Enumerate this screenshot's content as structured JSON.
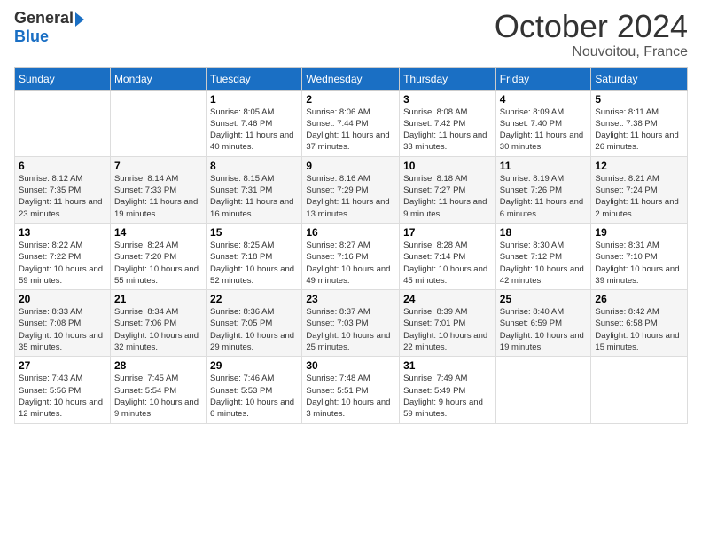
{
  "logo": {
    "general": "General",
    "blue": "Blue"
  },
  "header": {
    "month": "October 2024",
    "location": "Nouvoitou, France"
  },
  "weekdays": [
    "Sunday",
    "Monday",
    "Tuesday",
    "Wednesday",
    "Thursday",
    "Friday",
    "Saturday"
  ],
  "weeks": [
    [
      {
        "day": "",
        "sunrise": "",
        "sunset": "",
        "daylight": ""
      },
      {
        "day": "",
        "sunrise": "",
        "sunset": "",
        "daylight": ""
      },
      {
        "day": "1",
        "sunrise": "Sunrise: 8:05 AM",
        "sunset": "Sunset: 7:46 PM",
        "daylight": "Daylight: 11 hours and 40 minutes."
      },
      {
        "day": "2",
        "sunrise": "Sunrise: 8:06 AM",
        "sunset": "Sunset: 7:44 PM",
        "daylight": "Daylight: 11 hours and 37 minutes."
      },
      {
        "day": "3",
        "sunrise": "Sunrise: 8:08 AM",
        "sunset": "Sunset: 7:42 PM",
        "daylight": "Daylight: 11 hours and 33 minutes."
      },
      {
        "day": "4",
        "sunrise": "Sunrise: 8:09 AM",
        "sunset": "Sunset: 7:40 PM",
        "daylight": "Daylight: 11 hours and 30 minutes."
      },
      {
        "day": "5",
        "sunrise": "Sunrise: 8:11 AM",
        "sunset": "Sunset: 7:38 PM",
        "daylight": "Daylight: 11 hours and 26 minutes."
      }
    ],
    [
      {
        "day": "6",
        "sunrise": "Sunrise: 8:12 AM",
        "sunset": "Sunset: 7:35 PM",
        "daylight": "Daylight: 11 hours and 23 minutes."
      },
      {
        "day": "7",
        "sunrise": "Sunrise: 8:14 AM",
        "sunset": "Sunset: 7:33 PM",
        "daylight": "Daylight: 11 hours and 19 minutes."
      },
      {
        "day": "8",
        "sunrise": "Sunrise: 8:15 AM",
        "sunset": "Sunset: 7:31 PM",
        "daylight": "Daylight: 11 hours and 16 minutes."
      },
      {
        "day": "9",
        "sunrise": "Sunrise: 8:16 AM",
        "sunset": "Sunset: 7:29 PM",
        "daylight": "Daylight: 11 hours and 13 minutes."
      },
      {
        "day": "10",
        "sunrise": "Sunrise: 8:18 AM",
        "sunset": "Sunset: 7:27 PM",
        "daylight": "Daylight: 11 hours and 9 minutes."
      },
      {
        "day": "11",
        "sunrise": "Sunrise: 8:19 AM",
        "sunset": "Sunset: 7:26 PM",
        "daylight": "Daylight: 11 hours and 6 minutes."
      },
      {
        "day": "12",
        "sunrise": "Sunrise: 8:21 AM",
        "sunset": "Sunset: 7:24 PM",
        "daylight": "Daylight: 11 hours and 2 minutes."
      }
    ],
    [
      {
        "day": "13",
        "sunrise": "Sunrise: 8:22 AM",
        "sunset": "Sunset: 7:22 PM",
        "daylight": "Daylight: 10 hours and 59 minutes."
      },
      {
        "day": "14",
        "sunrise": "Sunrise: 8:24 AM",
        "sunset": "Sunset: 7:20 PM",
        "daylight": "Daylight: 10 hours and 55 minutes."
      },
      {
        "day": "15",
        "sunrise": "Sunrise: 8:25 AM",
        "sunset": "Sunset: 7:18 PM",
        "daylight": "Daylight: 10 hours and 52 minutes."
      },
      {
        "day": "16",
        "sunrise": "Sunrise: 8:27 AM",
        "sunset": "Sunset: 7:16 PM",
        "daylight": "Daylight: 10 hours and 49 minutes."
      },
      {
        "day": "17",
        "sunrise": "Sunrise: 8:28 AM",
        "sunset": "Sunset: 7:14 PM",
        "daylight": "Daylight: 10 hours and 45 minutes."
      },
      {
        "day": "18",
        "sunrise": "Sunrise: 8:30 AM",
        "sunset": "Sunset: 7:12 PM",
        "daylight": "Daylight: 10 hours and 42 minutes."
      },
      {
        "day": "19",
        "sunrise": "Sunrise: 8:31 AM",
        "sunset": "Sunset: 7:10 PM",
        "daylight": "Daylight: 10 hours and 39 minutes."
      }
    ],
    [
      {
        "day": "20",
        "sunrise": "Sunrise: 8:33 AM",
        "sunset": "Sunset: 7:08 PM",
        "daylight": "Daylight: 10 hours and 35 minutes."
      },
      {
        "day": "21",
        "sunrise": "Sunrise: 8:34 AM",
        "sunset": "Sunset: 7:06 PM",
        "daylight": "Daylight: 10 hours and 32 minutes."
      },
      {
        "day": "22",
        "sunrise": "Sunrise: 8:36 AM",
        "sunset": "Sunset: 7:05 PM",
        "daylight": "Daylight: 10 hours and 29 minutes."
      },
      {
        "day": "23",
        "sunrise": "Sunrise: 8:37 AM",
        "sunset": "Sunset: 7:03 PM",
        "daylight": "Daylight: 10 hours and 25 minutes."
      },
      {
        "day": "24",
        "sunrise": "Sunrise: 8:39 AM",
        "sunset": "Sunset: 7:01 PM",
        "daylight": "Daylight: 10 hours and 22 minutes."
      },
      {
        "day": "25",
        "sunrise": "Sunrise: 8:40 AM",
        "sunset": "Sunset: 6:59 PM",
        "daylight": "Daylight: 10 hours and 19 minutes."
      },
      {
        "day": "26",
        "sunrise": "Sunrise: 8:42 AM",
        "sunset": "Sunset: 6:58 PM",
        "daylight": "Daylight: 10 hours and 15 minutes."
      }
    ],
    [
      {
        "day": "27",
        "sunrise": "Sunrise: 7:43 AM",
        "sunset": "Sunset: 5:56 PM",
        "daylight": "Daylight: 10 hours and 12 minutes."
      },
      {
        "day": "28",
        "sunrise": "Sunrise: 7:45 AM",
        "sunset": "Sunset: 5:54 PM",
        "daylight": "Daylight: 10 hours and 9 minutes."
      },
      {
        "day": "29",
        "sunrise": "Sunrise: 7:46 AM",
        "sunset": "Sunset: 5:53 PM",
        "daylight": "Daylight: 10 hours and 6 minutes."
      },
      {
        "day": "30",
        "sunrise": "Sunrise: 7:48 AM",
        "sunset": "Sunset: 5:51 PM",
        "daylight": "Daylight: 10 hours and 3 minutes."
      },
      {
        "day": "31",
        "sunrise": "Sunrise: 7:49 AM",
        "sunset": "Sunset: 5:49 PM",
        "daylight": "Daylight: 9 hours and 59 minutes."
      },
      {
        "day": "",
        "sunrise": "",
        "sunset": "",
        "daylight": ""
      },
      {
        "day": "",
        "sunrise": "",
        "sunset": "",
        "daylight": ""
      }
    ]
  ]
}
